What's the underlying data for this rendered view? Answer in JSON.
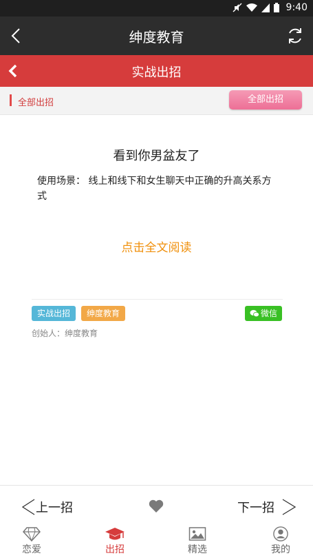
{
  "status_bar": {
    "time": "9:40"
  },
  "app_bar": {
    "title": "绅度教育"
  },
  "sub_bar": {
    "title": "实战出招"
  },
  "filter": {
    "label": "全部出招",
    "button": "全部出招"
  },
  "article": {
    "title": "看到你男盆友了",
    "description": "使用场景： 线上和线下和女生聊天中正确的升高关系方式",
    "read_more": "点击全文阅读",
    "tags": [
      "实战出招",
      "绅度教育"
    ],
    "share": "微信",
    "creator": "创始人：绅度教育"
  },
  "pager": {
    "prev": "上一招",
    "next": "下一招"
  },
  "tabs": [
    {
      "label": "恋爱",
      "icon": "diamond-icon"
    },
    {
      "label": "出招",
      "icon": "graduation-cap-icon",
      "active": true
    },
    {
      "label": "精选",
      "icon": "picture-icon"
    },
    {
      "label": "我的",
      "icon": "user-icon"
    }
  ],
  "colors": {
    "accent": "#d63c3c",
    "readmore": "#f0900c",
    "tag_blue": "#55b7d8",
    "tag_orange": "#f2a847",
    "wechat": "#39c024"
  }
}
